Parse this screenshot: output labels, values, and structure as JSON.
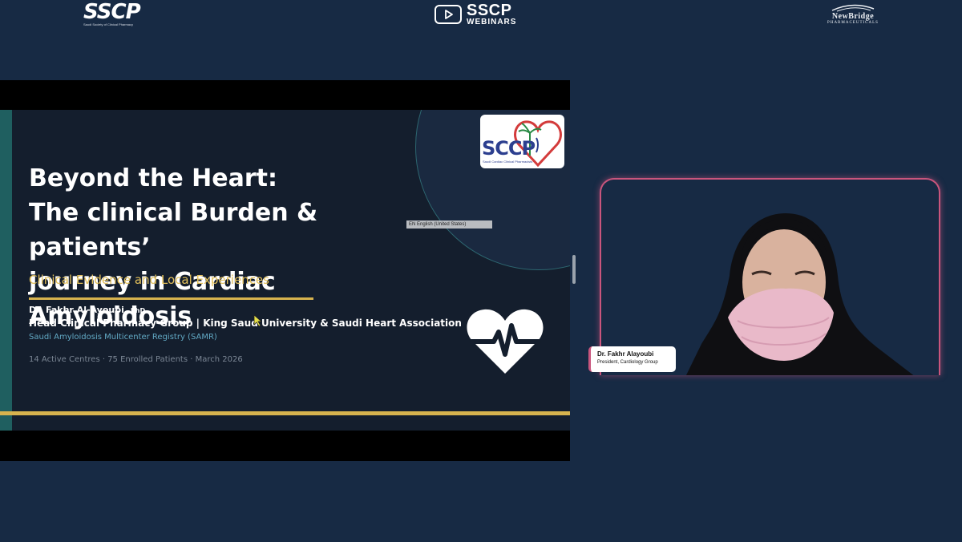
{
  "header": {
    "left_logo": {
      "text": "SSCP",
      "tagline": "Saudi Society of Clinical Pharmacy"
    },
    "center_logo": {
      "line1": "SSCP",
      "line2": "WEBINARS",
      "icon": "play-icon"
    },
    "right_logo": {
      "line1": "NewBridge",
      "line2": "PHARMACEUTICALS"
    }
  },
  "slide": {
    "title_line1": "Beyond the Heart:",
    "title_line2": "The clinical Burden & patients’",
    "title_line3": "journey in Cardiac Amyloidosis",
    "subtitle": "Clinical Evidence and Local Experiences",
    "author_name": "Dr. Fakhr Al-Ayoubi,",
    "author_degree": "PhD",
    "affiliation": "Head Clinical Pharmacy Group | King Saud University & Saudi Heart Association",
    "registry": "Saudi Amyloidosis Multicenter Registry (SAMR)",
    "stats": "14 Active Centres  ·  75 Enrolled Patients  ·  March  2026",
    "logo": {
      "text": "SCCP",
      "subtext": "Saudi Cardiac Clinical Pharmacists"
    },
    "language_bar": "EN English (United States)",
    "icon": "heart-ecg-icon"
  },
  "presenter": {
    "name": "Dr. Fakhr Alayoubi",
    "role": "President, Cardiology Group"
  },
  "colors": {
    "background": "#172a44",
    "slide_bg": "#141e2d",
    "accent_gold": "#d7b34e",
    "accent_teal": "#1f5f60",
    "camera_border": "#c9557d"
  }
}
